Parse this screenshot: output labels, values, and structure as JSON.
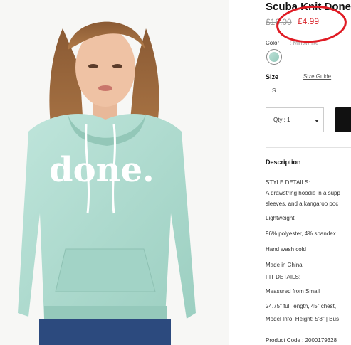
{
  "product": {
    "title": "Scuba Knit Done",
    "old_price": "£16.00",
    "sale_price": "£4.99",
    "graphic_text": "done."
  },
  "color": {
    "label": "Color",
    "value": ": Mint/white"
  },
  "size": {
    "label": "Size",
    "guide_link": "Size Guide",
    "selected": "S"
  },
  "quantity": {
    "label": "Qty : 1"
  },
  "description": {
    "heading": "Description",
    "lines": [
      "STYLE DETAILS:",
      "A drawstring hoodie in a supp",
      "sleeves, and a kangaroo poc",
      "Lightweight",
      "96% polyester, 4% spandex",
      "Hand wash cold",
      "Made in China",
      "FIT DETAILS:",
      "Measured from Small",
      "24.75\" full length, 45\" chest,",
      "Model Info: Height: 5'8\" | Bus",
      "Product Code : 2000179328"
    ]
  },
  "colors": {
    "sale": "#d9252b",
    "annotation": "#e01b24",
    "hoodie": "#a9d8cc",
    "button": "#111111"
  }
}
